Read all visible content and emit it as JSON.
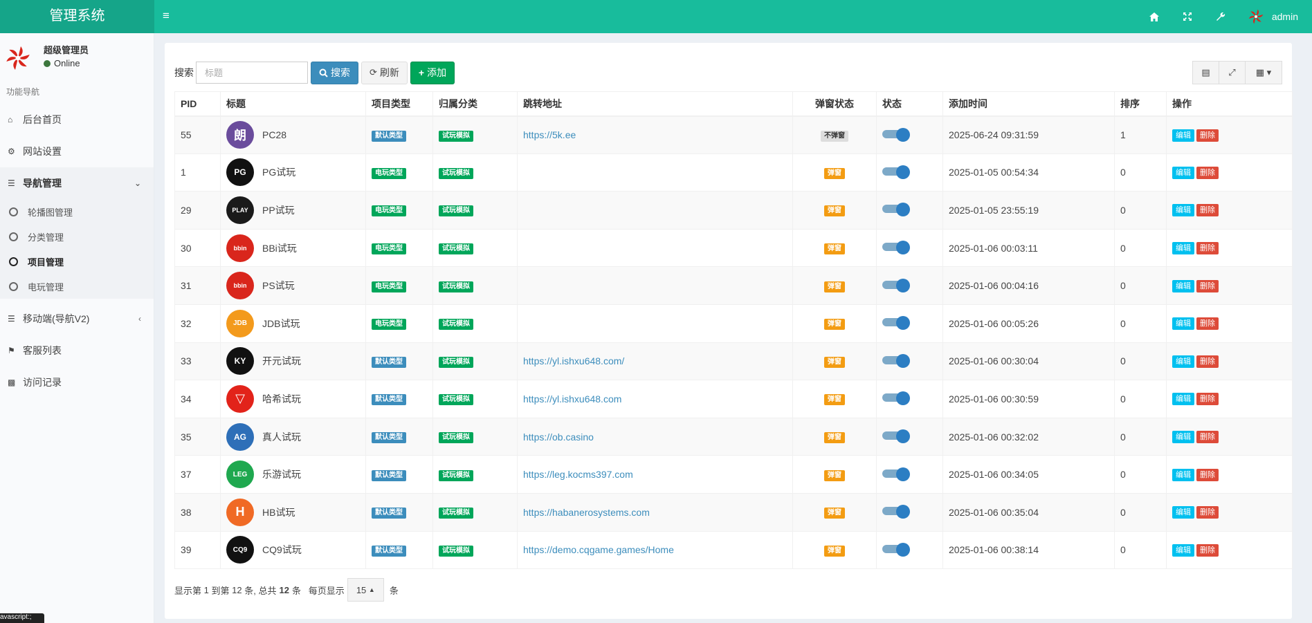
{
  "app": {
    "title": "管理系统",
    "user_name": "admin",
    "accent": "#18bc9c"
  },
  "sidebar": {
    "user_name": "超级管理员",
    "user_status": "Online",
    "section": "功能导航",
    "items": [
      {
        "label": "后台首页",
        "icon": "home-icon"
      },
      {
        "label": "网站设置",
        "icon": "gears-icon"
      },
      {
        "label": "导航管理",
        "icon": "database-icon",
        "expanded": true
      },
      {
        "label": "移动端(导航V2)",
        "icon": "database-icon"
      },
      {
        "label": "客服列表",
        "icon": "tag-icon"
      },
      {
        "label": "访问记录",
        "icon": "bar-chart-icon"
      }
    ],
    "subitems": [
      {
        "label": "轮播图管理"
      },
      {
        "label": "分类管理"
      },
      {
        "label": "项目管理",
        "active": true
      },
      {
        "label": "电玩管理"
      }
    ]
  },
  "toolbar": {
    "search_label": "搜索",
    "search_placeholder": "标题",
    "search_button": "搜索",
    "refresh_button": "刷新",
    "add_button": "添加"
  },
  "table": {
    "headers": [
      "PID",
      "标题",
      "项目类型",
      "归属分类",
      "跳转地址",
      "弹窗状态",
      "状态",
      "添加时间",
      "排序",
      "操作"
    ],
    "edit_label": "编辑",
    "delete_label": "删除",
    "rows": [
      {
        "pid": "55",
        "title": "PC28",
        "logo": "朗",
        "logo_color": "#6a4c9c",
        "type": "默认类型",
        "cat": "试玩模拟",
        "url": "https://5k.ee",
        "popup": "不弹窗",
        "time": "2025-06-24 09:31:59",
        "sort": "1"
      },
      {
        "pid": "1",
        "title": "PG试玩",
        "logo": "PG",
        "logo_color": "#111111",
        "type": "电玩类型",
        "cat": "试玩模拟",
        "url": "",
        "popup": "弹窗",
        "time": "2025-01-05 00:54:34",
        "sort": "0"
      },
      {
        "pid": "29",
        "title": "PP试玩",
        "logo": "PLAY",
        "logo_color": "#1a1a1a",
        "type": "电玩类型",
        "cat": "试玩模拟",
        "url": "",
        "popup": "弹窗",
        "time": "2025-01-05 23:55:19",
        "sort": "0"
      },
      {
        "pid": "30",
        "title": "BBi试玩",
        "logo": "bbin",
        "logo_color": "#d9261c",
        "type": "电玩类型",
        "cat": "试玩模拟",
        "url": "",
        "popup": "弹窗",
        "time": "2025-01-06 00:03:11",
        "sort": "0"
      },
      {
        "pid": "31",
        "title": "PS试玩",
        "logo": "bbin",
        "logo_color": "#d9261c",
        "type": "电玩类型",
        "cat": "试玩模拟",
        "url": "",
        "popup": "弹窗",
        "time": "2025-01-06 00:04:16",
        "sort": "0"
      },
      {
        "pid": "32",
        "title": "JDB试玩",
        "logo": "JDB",
        "logo_color": "#f39a1c",
        "type": "电玩类型",
        "cat": "试玩模拟",
        "url": "",
        "popup": "弹窗",
        "time": "2025-01-06 00:05:26",
        "sort": "0"
      },
      {
        "pid": "33",
        "title": "开元试玩",
        "logo": "KY",
        "logo_color": "#111111",
        "type": "默认类型",
        "cat": "试玩模拟",
        "url": "https://yl.ishxu648.com/",
        "popup": "弹窗",
        "time": "2025-01-06 00:30:04",
        "sort": "0"
      },
      {
        "pid": "34",
        "title": "哈希试玩",
        "logo": "▽",
        "logo_color": "#e2231a",
        "type": "默认类型",
        "cat": "试玩模拟",
        "url": "https://yl.ishxu648.com",
        "popup": "弹窗",
        "time": "2025-01-06 00:30:59",
        "sort": "0"
      },
      {
        "pid": "35",
        "title": "真人试玩",
        "logo": "AG",
        "logo_color": "#2e6fb8",
        "type": "默认类型",
        "cat": "试玩模拟",
        "url": "https://ob.casino",
        "popup": "弹窗",
        "time": "2025-01-06 00:32:02",
        "sort": "0"
      },
      {
        "pid": "37",
        "title": "乐游试玩",
        "logo": "LEG",
        "logo_color": "#1fa84f",
        "type": "默认类型",
        "cat": "试玩模拟",
        "url": "https://leg.kocms397.com",
        "popup": "弹窗",
        "time": "2025-01-06 00:34:05",
        "sort": "0"
      },
      {
        "pid": "38",
        "title": "HB试玩",
        "logo": "H",
        "logo_color": "#f06a25",
        "type": "默认类型",
        "cat": "试玩模拟",
        "url": "https://habanerosystems.com",
        "popup": "弹窗",
        "time": "2025-01-06 00:35:04",
        "sort": "0"
      },
      {
        "pid": "39",
        "title": "CQ9试玩",
        "logo": "CQ9",
        "logo_color": "#111111",
        "type": "默认类型",
        "cat": "试玩模拟",
        "url": "https://demo.cqgame.games/Home",
        "popup": "弹窗",
        "time": "2025-01-06 00:38:14",
        "sort": "0"
      }
    ]
  },
  "pager": {
    "text_a": "显示第",
    "from": "1",
    "text_b": "到第",
    "to": "12",
    "text_c": "条, 总共",
    "total": "12",
    "text_d": "条",
    "per_page_label": "每页显示",
    "per_page": "15",
    "text_e": "条"
  },
  "status_bar": {
    "text": "avascript:;"
  }
}
